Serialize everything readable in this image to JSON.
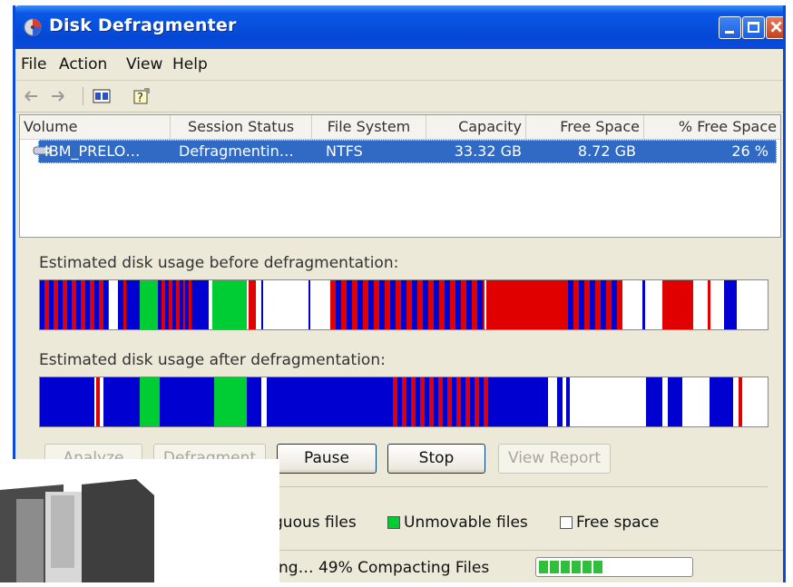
{
  "window": {
    "title": "Disk Defragmenter"
  },
  "menu": {
    "items": [
      "File",
      "Action",
      "View",
      "Help"
    ]
  },
  "toolbar": {
    "icons": [
      "back-arrow-icon",
      "forward-arrow-icon",
      "properties-icon",
      "help-icon"
    ]
  },
  "volumes": {
    "columns": [
      "Volume",
      "Session Status",
      "File System",
      "Capacity",
      "Free Space",
      "% Free Space"
    ],
    "rows": [
      {
        "volume": "IBM_PRELO…",
        "status": "Defragmentin…",
        "fs": "NTFS",
        "capacity": "33.32 GB",
        "free": "8.72 GB",
        "pct_free": "26 %"
      }
    ]
  },
  "before": {
    "label": "Estimated disk usage before defragmentation:"
  },
  "after": {
    "label": "Estimated disk usage after defragmentation:"
  },
  "buttons": {
    "analyze": "Analyze",
    "defragment": "Defragment",
    "pause": "Pause",
    "stop": "Stop",
    "view_report": "View Report"
  },
  "legend": {
    "fragmented_partial": "guous files",
    "unmovable": "Unmovable files",
    "free": "Free space",
    "colors": {
      "fragmented": "#e00000",
      "contiguous": "#0000d0",
      "unmovable": "#00cc33",
      "free": "#ffffff"
    }
  },
  "status": {
    "text": "ng… 49%  Compacting Files",
    "progress": 0.49
  }
}
